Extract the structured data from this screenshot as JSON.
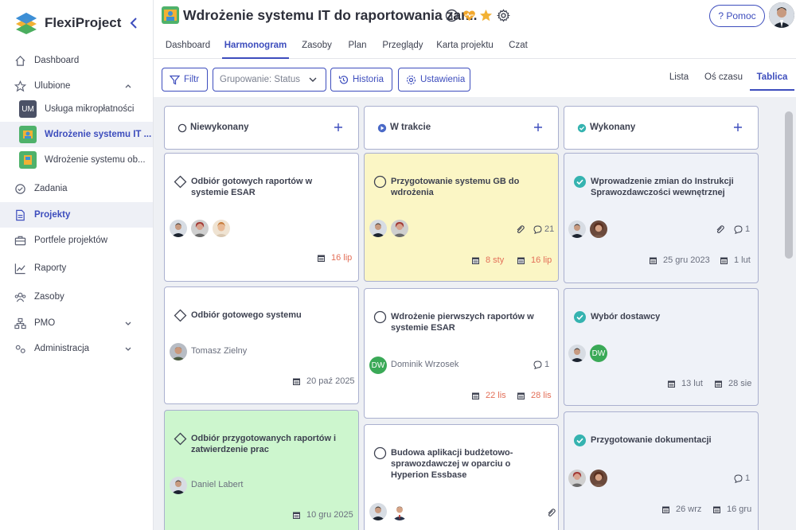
{
  "app": {
    "name": "FlexiProject"
  },
  "sidebar": {
    "nav": [
      {
        "label": "Dashboard",
        "icon": "home-icon"
      },
      {
        "label": "Ulubione",
        "icon": "star-icon"
      },
      {
        "label": "Zadania",
        "icon": "check-circle-icon"
      },
      {
        "label": "Projekty",
        "icon": "document-icon"
      },
      {
        "label": "Portfele projektów",
        "icon": "briefcase-icon"
      },
      {
        "label": "Raporty",
        "icon": "chart-line-icon"
      },
      {
        "label": "Zasoby",
        "icon": "people-icon"
      },
      {
        "label": "PMO",
        "icon": "org-chart-icon"
      },
      {
        "label": "Administracja",
        "icon": "settings-icon"
      }
    ],
    "favorites": [
      {
        "badge": "UM",
        "label": "Usługa mikropłatności"
      },
      {
        "badge": "",
        "label": "Wdrożenie systemu IT ..."
      },
      {
        "badge": "",
        "label": "Wdrożenie systemu ob..."
      }
    ]
  },
  "header": {
    "title": "Wdrożenie systemu IT do raportowania zar...",
    "help": "? Pomoc"
  },
  "tabs": [
    "Dashboard",
    "Harmonogram",
    "Zasoby",
    "Plan",
    "Przeglądy",
    "Karta projektu",
    "Czat"
  ],
  "toolbar": {
    "filter": "Filtr",
    "grouping": "Grupowanie: Status",
    "history": "Historia",
    "settings": "Ustawienia",
    "views": [
      "Lista",
      "Oś czasu",
      "Tablica"
    ]
  },
  "columns": [
    {
      "label": "Niewykonany"
    },
    {
      "label": "W trakcie"
    },
    {
      "label": "Wykonany"
    }
  ],
  "cards": {
    "c1": {
      "title": "Odbiór gotowych raportów w systemie ESAR",
      "due": "16 lip"
    },
    "c2": {
      "title": "Odbiór gotowego systemu",
      "assignee": "Tomasz Zielny",
      "due": "20 paź 2025"
    },
    "c3": {
      "title": "Odbiór przygotowanych raportów i zatwierdzenie prac",
      "assignee": "Daniel Labert",
      "due": "10 gru 2025"
    },
    "c4": {
      "title": "Przygotowanie systemu GB do wdrożenia",
      "comments": "21",
      "start": "8 sty",
      "due": "16 lip"
    },
    "c5": {
      "title": "Wdrożenie pierwszych raportów w systemie ESAR",
      "avatar": "DW",
      "assignee": "Dominik Wrzosek",
      "comments": "1",
      "start": "22 lis",
      "due": "28 lis"
    },
    "c6": {
      "title": "Budowa aplikacji budżetowo-sprawozdawczej w oparciu o Hyperion Essbase"
    },
    "c7": {
      "title": "Wprowadzenie zmian do Instrukcji Sprawozdawczości wewnętrznej",
      "comments": "1",
      "start": "25 gru 2023",
      "due": "1 lut"
    },
    "c8": {
      "title": "Wybór dostawcy",
      "avatar": "DW",
      "start": "13 lut",
      "due": "28 sie"
    },
    "c9": {
      "title": "Przygotowanie dokumentacji",
      "comments": "1",
      "start": "26 wrz",
      "due": "16 gru"
    }
  }
}
